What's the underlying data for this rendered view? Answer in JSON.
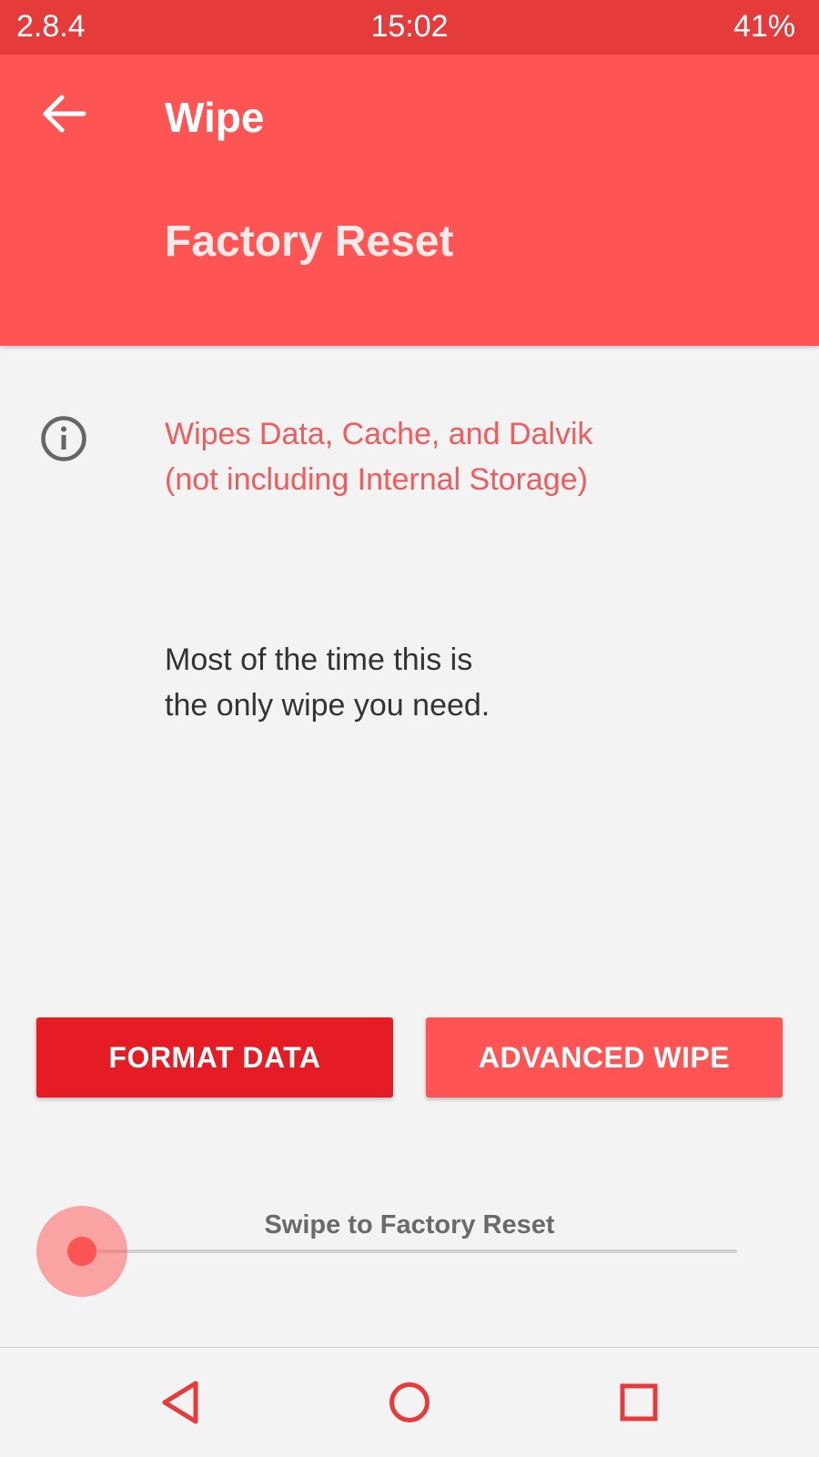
{
  "status_bar": {
    "version": "2.8.4",
    "time": "15:02",
    "battery": "41%"
  },
  "app_bar": {
    "title": "Wipe",
    "subtitle": "Factory Reset",
    "back_icon": "arrow-left-icon"
  },
  "info": {
    "icon": "info-icon",
    "lines": [
      "Wipes Data, Cache, and Dalvik",
      "(not including Internal Storage)"
    ]
  },
  "body": {
    "lines": [
      "Most of the time this is",
      "the only wipe you need."
    ]
  },
  "buttons": {
    "format_data": "FORMAT DATA",
    "advanced_wipe": "ADVANCED WIPE"
  },
  "swipe": {
    "label": "Swipe to Factory Reset",
    "progress": 0
  },
  "nav_bar": {
    "back_icon": "triangle-back-icon",
    "home_icon": "circle-home-icon",
    "recent_icon": "square-recents-icon"
  },
  "colors": {
    "status_bar": "#e53b3b",
    "app_bar": "#ff5454",
    "accent_text": "#f25b5b",
    "format_button": "#e51c24",
    "advanced_button": "#ff5454",
    "nav_icons": "#e53b3b"
  }
}
